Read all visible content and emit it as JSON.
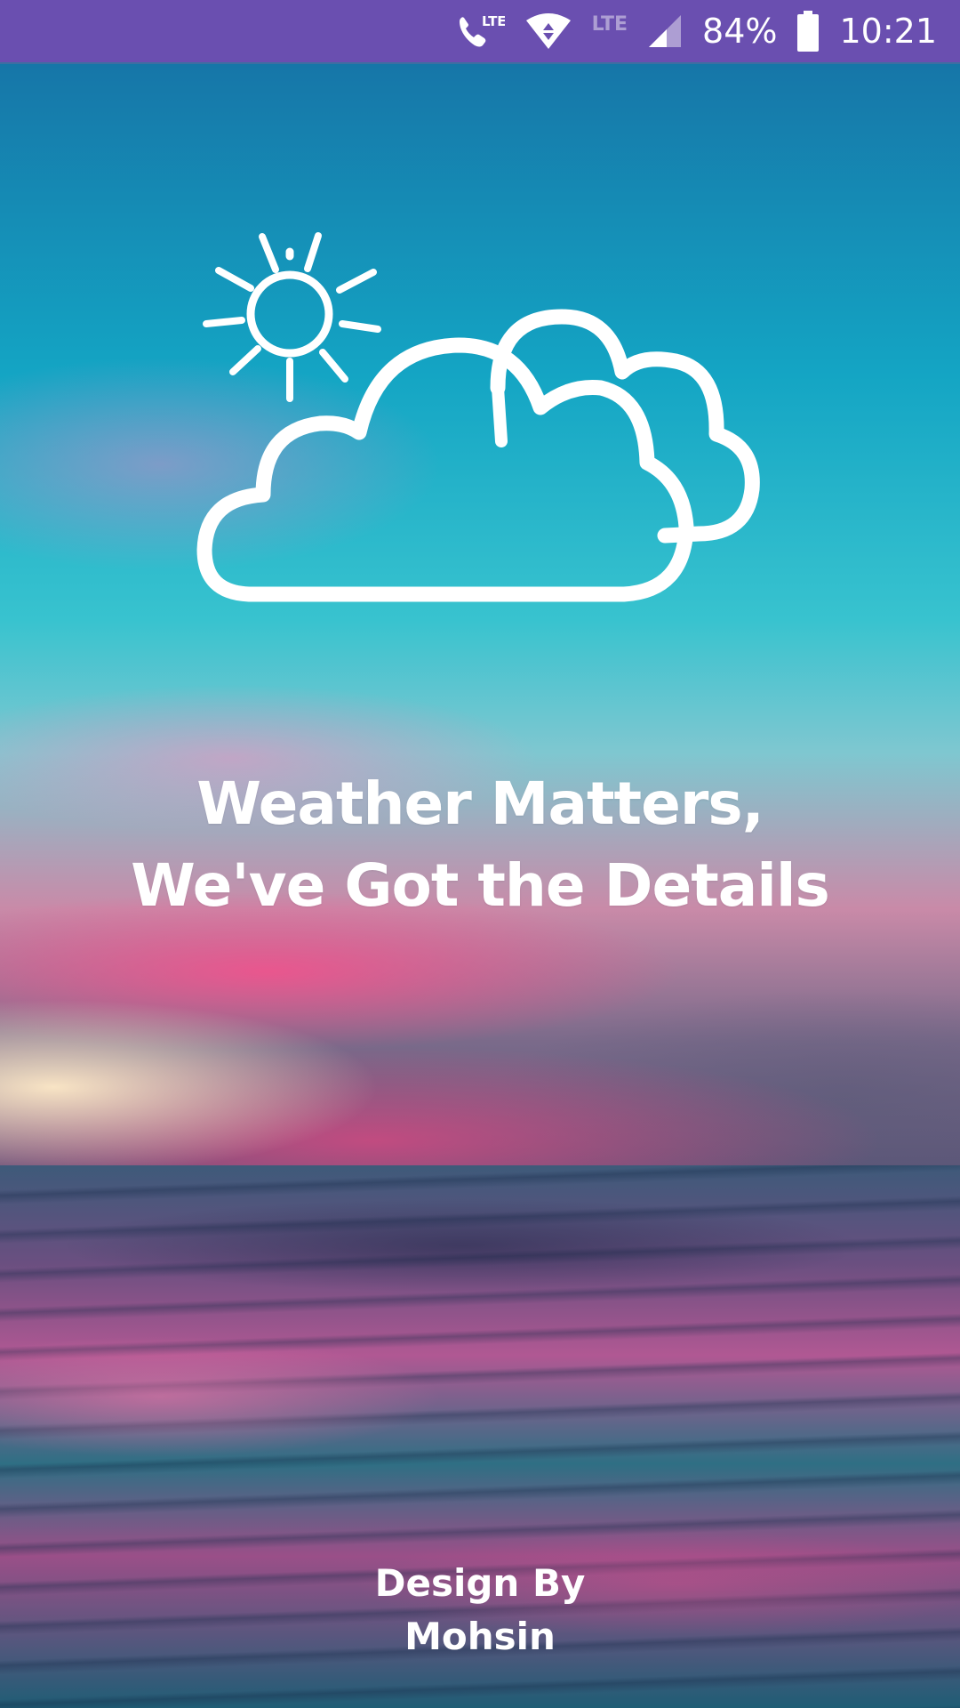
{
  "status_bar": {
    "call_lte_icon": "call-lte-icon",
    "wifi_icon": "wifi-icon",
    "lte_label": "LTE",
    "signal_icon": "signal-icon",
    "battery_percent": "84%",
    "battery_icon": "battery-icon",
    "time": "10:21",
    "background_color": "#6a4fb0"
  },
  "splash": {
    "icon": "partly-cloudy-icon",
    "headline_line1": "Weather Matters,",
    "headline_line2": "We've Got the Details",
    "credit_line1": "Design By",
    "credit_line2": "Mohsin"
  }
}
